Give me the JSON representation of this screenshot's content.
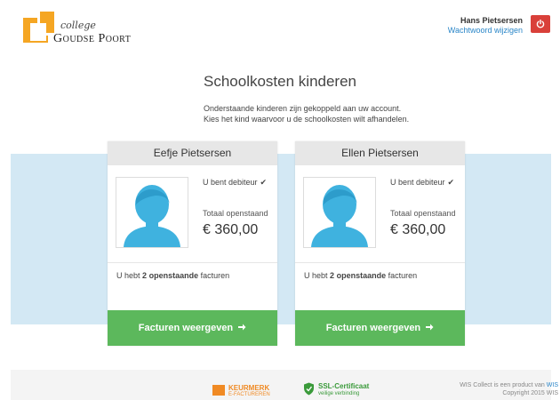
{
  "header": {
    "logo_small": "college",
    "logo_main": "Goudse Poort",
    "user_name": "Hans Pietsersen",
    "change_password": "Wachtwoord wijzigen",
    "logout_icon": "power-icon",
    "logout_color": "#d9403a"
  },
  "intro": {
    "title": "Schoolkosten kinderen",
    "line1": "Onderstaande kinderen zijn gekoppeld aan uw account.",
    "line2": "Kies het kind waarvoor u de schoolkosten wilt afhandelen."
  },
  "children": [
    {
      "name": "Eefje Pietsersen",
      "debtor": "U bent debiteur",
      "total_label": "Totaal openstaand",
      "amount": "€ 360,00",
      "invoices_prefix": "U hebt",
      "invoices_count": "2",
      "invoices_strong": "openstaande",
      "invoices_suffix": "facturen",
      "button": "Facturen weergeven"
    },
    {
      "name": "Ellen Pietsersen",
      "debtor": "U bent debiteur",
      "total_label": "Totaal openstaand",
      "amount": "€ 360,00",
      "invoices_prefix": "U hebt",
      "invoices_count": "2",
      "invoices_strong": "openstaande",
      "invoices_suffix": "facturen",
      "button": "Facturen weergeven"
    }
  ],
  "footer": {
    "keurmerk_1": "KEURMERK",
    "keurmerk_2": "E-FACTUREREN",
    "ssl_1": "SSL-Certificaat",
    "ssl_2": "veilige verbinding",
    "wis_line1_prefix": "WIS Collect is een product van",
    "wis_brand": "WIS",
    "wis_line2": "Copyright 2015 WIS"
  },
  "colors": {
    "accent_orange": "#f5a623",
    "button_green": "#5cb85c",
    "band_blue": "#d3e8f4",
    "avatar_blue": "#3fb2df"
  }
}
